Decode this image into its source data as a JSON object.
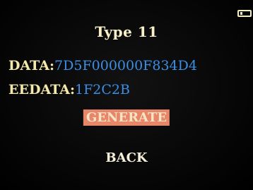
{
  "screen": {
    "title": "Type 11",
    "battery_icon": "battery-icon"
  },
  "fields": {
    "data_label": "DATA:",
    "data_value": "7D5F000000F834D4",
    "eedata_label": "EEDATA:",
    "eedata_value": "1F2C2B"
  },
  "menu": {
    "generate_label": "GENERATE",
    "back_label": "BACK",
    "selected": "GENERATE"
  },
  "colors": {
    "label": "#f3e9a8",
    "value": "#3a8fe6",
    "highlight": "#e8866a"
  }
}
